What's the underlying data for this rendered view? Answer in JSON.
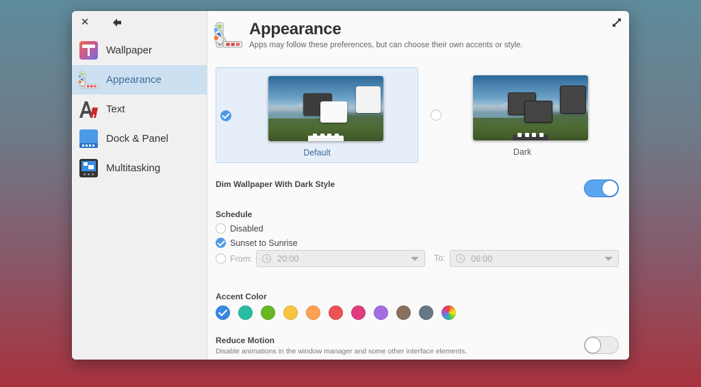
{
  "window": {
    "expand_icon": "expand-icon"
  },
  "sidebar": {
    "close_icon": "close-icon",
    "back_icon": "back-arrow-icon",
    "items": [
      {
        "label": "Wallpaper",
        "icon": "wallpaper-icon",
        "active": false
      },
      {
        "label": "Appearance",
        "icon": "appearance-icon",
        "active": true
      },
      {
        "label": "Text",
        "icon": "text-icon",
        "active": false
      },
      {
        "label": "Dock & Panel",
        "icon": "dock-panel-icon",
        "active": false
      },
      {
        "label": "Multitasking",
        "icon": "multitasking-icon",
        "active": false
      }
    ]
  },
  "header": {
    "title": "Appearance",
    "subtitle": "Apps may follow these preferences, but can choose their own accents or style."
  },
  "styles": [
    {
      "label": "Default",
      "selected": true
    },
    {
      "label": "Dark",
      "selected": false
    }
  ],
  "dim_wallpaper": {
    "label": "Dim Wallpaper With Dark Style",
    "enabled": true
  },
  "schedule": {
    "title": "Schedule",
    "options": [
      {
        "label": "Disabled",
        "selected": false
      },
      {
        "label": "Sunset to Sunrise",
        "selected": true
      }
    ],
    "from_label": "From:",
    "from_value": "20:00",
    "to_label": "To:",
    "to_value": "06:00"
  },
  "accent": {
    "title": "Accent Color",
    "colors": [
      {
        "name": "blue",
        "hex": "#3689e6",
        "selected": true
      },
      {
        "name": "mint",
        "hex": "#28bca3",
        "selected": false
      },
      {
        "name": "green",
        "hex": "#68b723",
        "selected": false
      },
      {
        "name": "yellow",
        "hex": "#f9c440",
        "selected": false
      },
      {
        "name": "orange",
        "hex": "#ffa154",
        "selected": false
      },
      {
        "name": "red",
        "hex": "#ed5353",
        "selected": false
      },
      {
        "name": "pink",
        "hex": "#de3e80",
        "selected": false
      },
      {
        "name": "purple",
        "hex": "#a56de2",
        "selected": false
      },
      {
        "name": "brown",
        "hex": "#8a715e",
        "selected": false
      },
      {
        "name": "gray",
        "hex": "#667885",
        "selected": false
      },
      {
        "name": "auto",
        "hex": "multicolor",
        "selected": false
      }
    ]
  },
  "reduce_motion": {
    "label": "Reduce Motion",
    "description": "Disable animations in the window manager and some other interface elements.",
    "enabled": false
  }
}
